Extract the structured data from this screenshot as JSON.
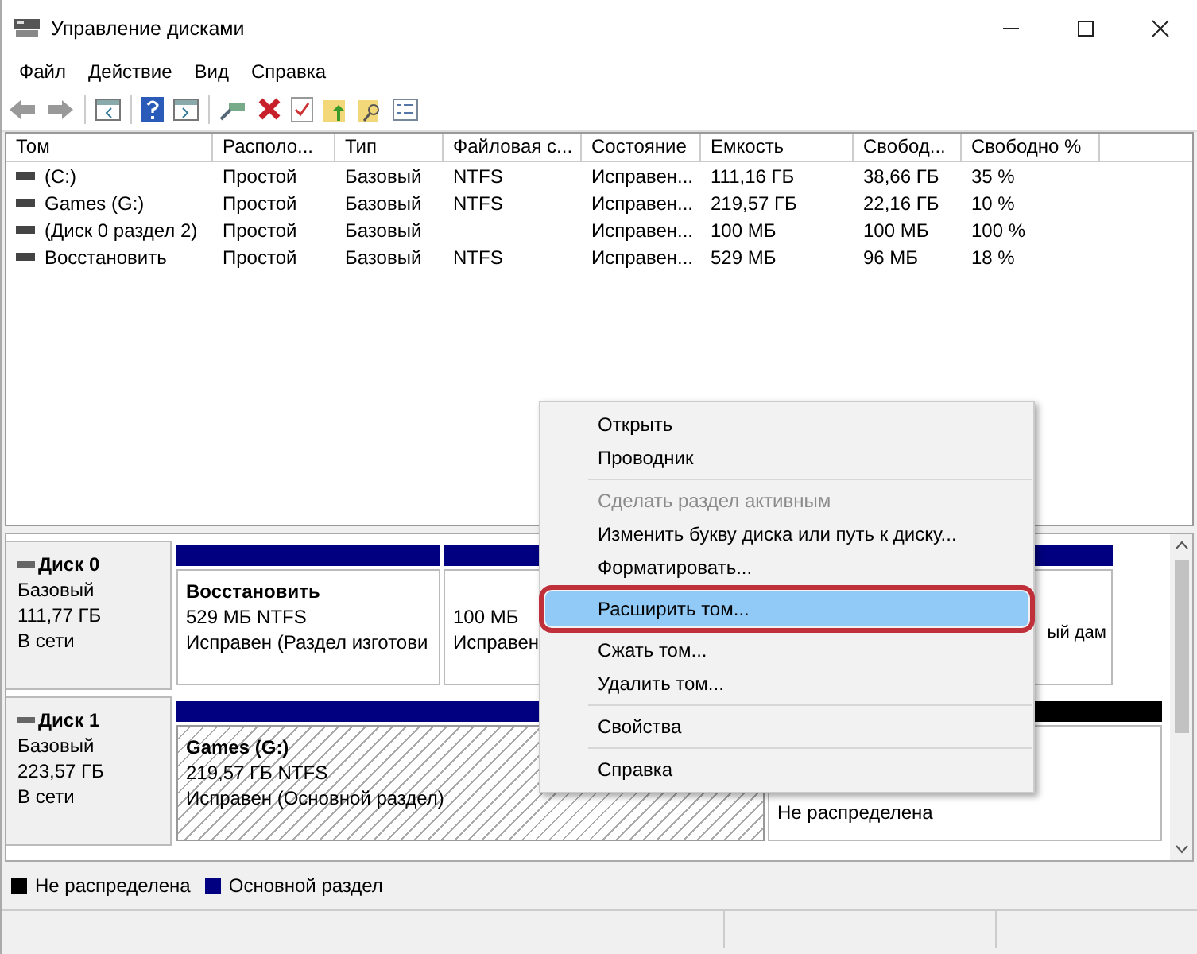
{
  "window": {
    "title": "Управление дисками"
  },
  "menubar": [
    "Файл",
    "Действие",
    "Вид",
    "Справка"
  ],
  "table": {
    "columns": [
      "Том",
      "Располо...",
      "Тип",
      "Файловая с...",
      "Состояние",
      "Емкость",
      "Свобод...",
      "Свободно %"
    ],
    "rows": [
      [
        "(C:)",
        "Простой",
        "Базовый",
        "NTFS",
        "Исправен...",
        "111,16 ГБ",
        "38,66 ГБ",
        "35 %"
      ],
      [
        "Games (G:)",
        "Простой",
        "Базовый",
        "NTFS",
        "Исправен...",
        "219,57 ГБ",
        "22,16 ГБ",
        "10 %"
      ],
      [
        "(Диск 0 раздел 2)",
        "Простой",
        "Базовый",
        "",
        "Исправен...",
        "100 МБ",
        "100 МБ",
        "100 %"
      ],
      [
        "Восстановить",
        "Простой",
        "Базовый",
        "NTFS",
        "Исправен...",
        "529 МБ",
        "96 МБ",
        "18 %"
      ]
    ]
  },
  "disks": [
    {
      "name": "Диск 0",
      "type": "Базовый",
      "size": "111,77 ГБ",
      "status": "В сети",
      "partitions": [
        {
          "kind": "primary",
          "selected": false,
          "label": "Восстановить",
          "size": "529 МБ NTFS",
          "status": "Исправен (Раздел изготови"
        },
        {
          "kind": "primary",
          "selected": false,
          "size": "100 МБ",
          "status": "Исправен"
        },
        {
          "kind": "primary",
          "selected": false,
          "status": "ый дам"
        }
      ]
    },
    {
      "name": "Диск 1",
      "type": "Базовый",
      "size": "223,57 ГБ",
      "status": "В сети",
      "partitions": [
        {
          "kind": "primary",
          "selected": true,
          "label": "Games  (G:)",
          "size": "219,57 ГБ NTFS",
          "status": "Исправен (Основной раздел)"
        },
        {
          "kind": "unallocated",
          "selected": false,
          "status": "Не распределена"
        }
      ]
    }
  ],
  "legend": [
    {
      "label": "Не распределена",
      "color": "#000000"
    },
    {
      "label": "Основной раздел",
      "color": "#000080"
    }
  ],
  "context_menu": [
    {
      "kind": "item",
      "label": "Открыть",
      "disabled": false,
      "selected": false
    },
    {
      "kind": "item",
      "label": "Проводник",
      "disabled": false,
      "selected": false
    },
    {
      "kind": "separator"
    },
    {
      "kind": "item",
      "label": "Сделать раздел активным",
      "disabled": true,
      "selected": false
    },
    {
      "kind": "item",
      "label": "Изменить букву диска или путь к диску...",
      "disabled": false,
      "selected": false
    },
    {
      "kind": "item",
      "label": "Форматировать...",
      "disabled": false,
      "selected": false
    },
    {
      "kind": "item",
      "label": "Расширить том...",
      "disabled": false,
      "selected": true
    },
    {
      "kind": "item",
      "label": "Сжать том...",
      "disabled": false,
      "selected": false
    },
    {
      "kind": "item",
      "label": "Удалить том...",
      "disabled": false,
      "selected": false
    },
    {
      "kind": "separator"
    },
    {
      "kind": "item",
      "label": "Свойства",
      "disabled": false,
      "selected": false
    },
    {
      "kind": "separator"
    },
    {
      "kind": "item",
      "label": "Справка",
      "disabled": false,
      "selected": false
    }
  ]
}
